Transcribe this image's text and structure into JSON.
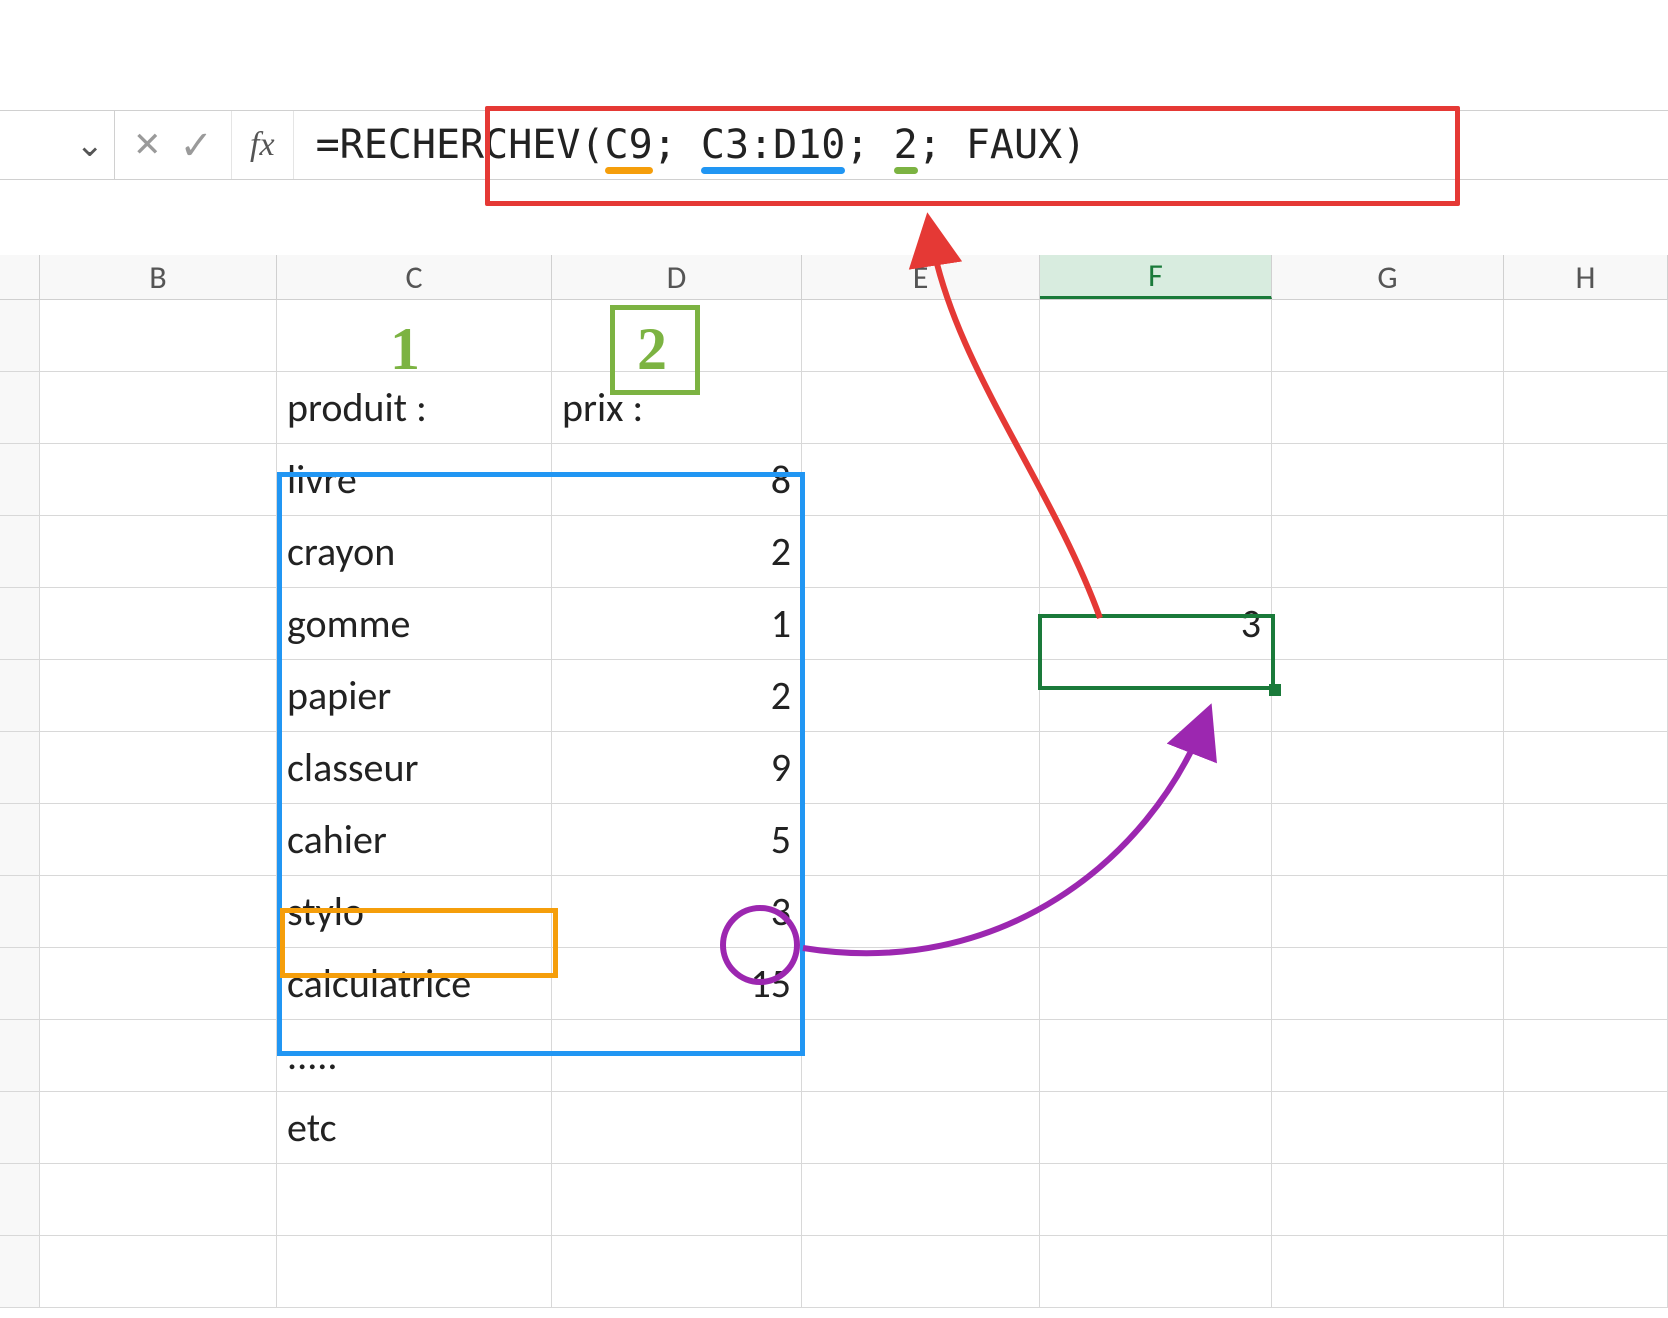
{
  "formula_bar": {
    "fx_label": "fx",
    "cancel_symbol": "✕",
    "confirm_symbol": "✓",
    "dropdown_symbol": "⌄",
    "formula": "=RECHERCHEV(C9; C3:D10; 2; FAUX)",
    "parts": {
      "prefix": "=RECHERCHEV(",
      "arg1": "C9",
      "sep1": "; ",
      "arg2": "C3:D10",
      "sep2": "; ",
      "arg3": "2",
      "sep3": "; ",
      "arg4": "FAUX",
      "suffix": ")"
    }
  },
  "columns": [
    "B",
    "C",
    "D",
    "E",
    "F",
    "G",
    "H"
  ],
  "active_column": "F",
  "annotations": {
    "col_index_1": "1",
    "col_index_2": "2"
  },
  "headers": {
    "produit": "produit :",
    "prix": "prix :"
  },
  "table": [
    {
      "produit": "livre",
      "prix": "8"
    },
    {
      "produit": "crayon",
      "prix": "2"
    },
    {
      "produit": "gomme",
      "prix": "1"
    },
    {
      "produit": "papier",
      "prix": "2"
    },
    {
      "produit": "classeur",
      "prix": "9"
    },
    {
      "produit": "cahier",
      "prix": "5"
    },
    {
      "produit": "stylo",
      "prix": "3"
    },
    {
      "produit": "calculatrice",
      "prix": "15"
    }
  ],
  "extra_rows": {
    "dots": ".....",
    "etc": "etc"
  },
  "result_cell": {
    "value": "3"
  },
  "chart_data": {
    "type": "table",
    "lookup_function": "RECHERCHEV",
    "lookup_value_ref": "C9",
    "table_range_ref": "C3:D10",
    "col_index": 2,
    "range_lookup": "FAUX",
    "result": 3,
    "columns": [
      "produit",
      "prix"
    ],
    "rows": [
      [
        "livre",
        8
      ],
      [
        "crayon",
        2
      ],
      [
        "gomme",
        1
      ],
      [
        "papier",
        2
      ],
      [
        "classeur",
        9
      ],
      [
        "cahier",
        5
      ],
      [
        "stylo",
        3
      ],
      [
        "calculatrice",
        15
      ]
    ]
  }
}
